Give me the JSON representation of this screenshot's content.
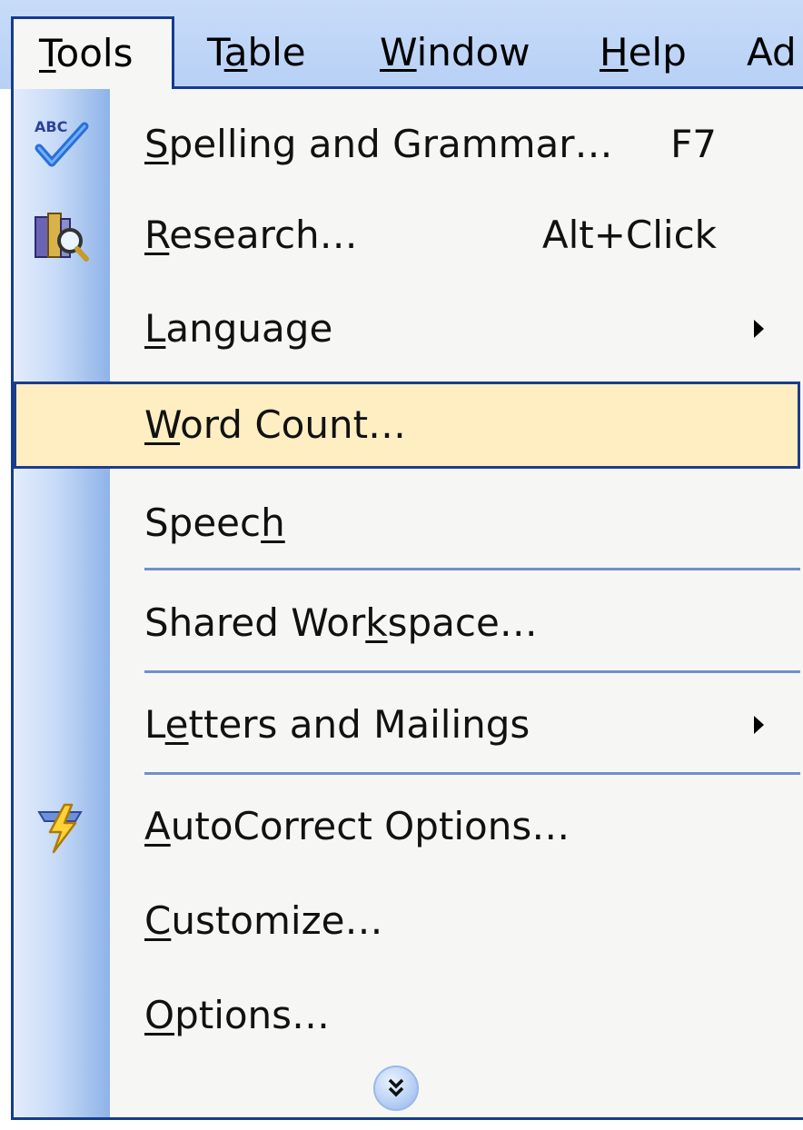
{
  "menubar": {
    "items": [
      {
        "pre": "",
        "u": "T",
        "post": "ools"
      },
      {
        "pre": "T",
        "u": "a",
        "post": "ble"
      },
      {
        "pre": "",
        "u": "W",
        "post": "indow"
      },
      {
        "pre": "",
        "u": "H",
        "post": "elp"
      },
      {
        "pre": "Ad",
        "u": "",
        "post": ""
      }
    ]
  },
  "menu": {
    "items": [
      {
        "pre": "",
        "u": "S",
        "post": "pelling and Grammar…",
        "shortcut": "F7",
        "icon": "spelling-abc-check-icon"
      },
      {
        "pre": "",
        "u": "R",
        "post": "esearch…",
        "shortcut": "Alt+Click",
        "icon": "research-book-magnifier-icon"
      },
      {
        "pre": "",
        "u": "L",
        "post": "anguage",
        "icon": "submenu-arrow-icon"
      },
      {
        "pre": "",
        "u": "W",
        "post": "ord Count…",
        "highlighted": true
      },
      {
        "pre": "Speec",
        "u": "h",
        "post": ""
      },
      {
        "pre": "Shared Wor",
        "u": "k",
        "post": "space…"
      },
      {
        "pre": "L",
        "u": "e",
        "post": "tters and Mailings",
        "icon": "submenu-arrow-icon"
      },
      {
        "pre": "",
        "u": "A",
        "post": "utoCorrect Options…",
        "icon": "autocorrect-lightning-icon"
      },
      {
        "pre": "",
        "u": "C",
        "post": "ustomize…"
      },
      {
        "pre": "",
        "u": "O",
        "post": "ptions…"
      }
    ],
    "expand_icon": "chevron-double-down-icon"
  },
  "colors": {
    "menubar_bg": "#c8dcf9",
    "menu_bg": "#f6f6f4",
    "border": "#163b8e",
    "highlight": "#ffeec2",
    "separator": "#6f8fcf"
  }
}
